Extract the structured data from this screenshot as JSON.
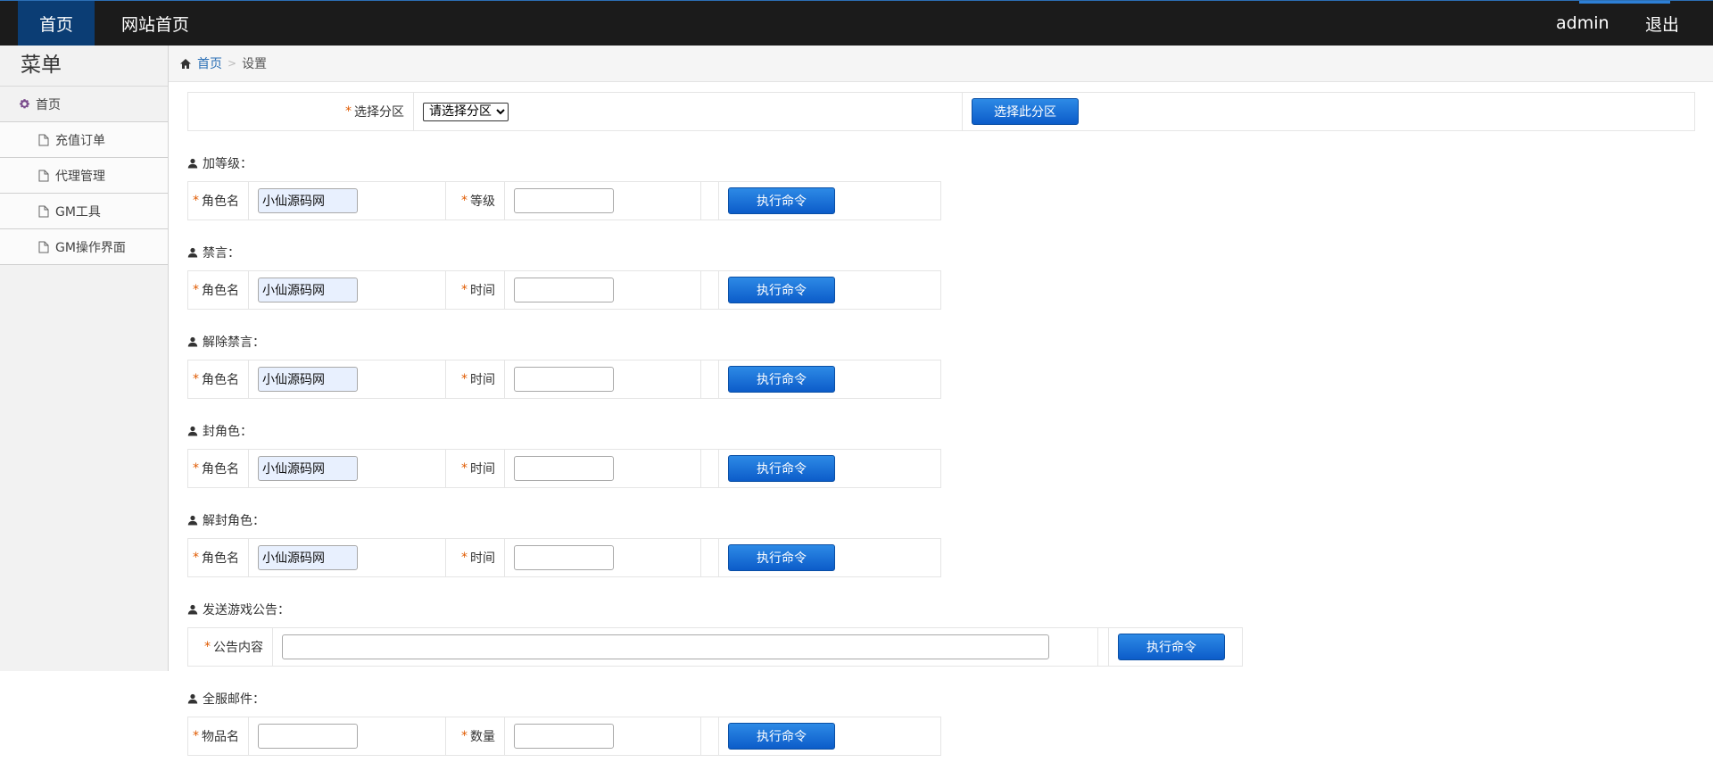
{
  "topbar": {
    "home": "首页",
    "site_home": "网站首页",
    "user": "admin",
    "logout": "退出"
  },
  "sidebar": {
    "title": "菜单",
    "home": "首页",
    "items": [
      {
        "label": "充值订单"
      },
      {
        "label": "代理管理"
      },
      {
        "label": "GM工具"
      },
      {
        "label": "GM操作界面"
      }
    ]
  },
  "breadcrumb": {
    "home": "首页",
    "current": "设置"
  },
  "required_mark": "*",
  "server": {
    "label": "选择分区",
    "select_value": "请选择分区",
    "button": "选择此分区"
  },
  "sections": [
    {
      "title": "加等级：",
      "field1_label": "角色名",
      "field1_value": "小仙源码网",
      "field2_label": "等级",
      "field2_value": "",
      "button": "执行命令"
    },
    {
      "title": "禁言：",
      "field1_label": "角色名",
      "field1_value": "小仙源码网",
      "field2_label": "时间",
      "field2_value": "",
      "button": "执行命令"
    },
    {
      "title": "解除禁言：",
      "field1_label": "角色名",
      "field1_value": "小仙源码网",
      "field2_label": "时间",
      "field2_value": "",
      "button": "执行命令"
    },
    {
      "title": "封角色：",
      "field1_label": "角色名",
      "field1_value": "小仙源码网",
      "field2_label": "时间",
      "field2_value": "",
      "button": "执行命令"
    },
    {
      "title": "解封角色：",
      "field1_label": "角色名",
      "field1_value": "小仙源码网",
      "field2_label": "时间",
      "field2_value": "",
      "button": "执行命令"
    }
  ],
  "notice": {
    "title": "发送游戏公告：",
    "label": "公告内容",
    "value": "",
    "button": "执行命令"
  },
  "mail": {
    "title": "全服邮件：",
    "field1_label": "物品名",
    "field1_value": "",
    "field2_label": "数量",
    "field2_value": "",
    "button": "执行命令"
  },
  "icons": {
    "menu_home": "gear-icon",
    "menu_item": "document-icon",
    "breadcrumb_home": "home-icon",
    "section": "user-icon"
  },
  "colors": {
    "topbar_bg": "#1b1b1b",
    "nav_active_bg": "#0b3d74",
    "button_blue": "#0c5cc9",
    "required": "#e05a00",
    "link": "#2a6fb5"
  }
}
